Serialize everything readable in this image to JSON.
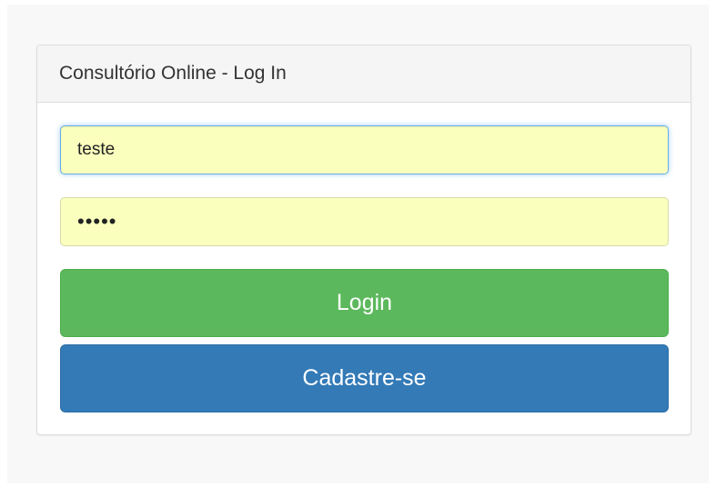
{
  "panel": {
    "title": "Consultório Online - Log In"
  },
  "form": {
    "username_value": "teste",
    "password_mask": "•••••"
  },
  "buttons": {
    "login_label": "Login",
    "register_label": "Cadastre-se"
  },
  "colors": {
    "login_button": "#5cb85c",
    "register_button": "#337ab7",
    "autofill_field": "#faffbd",
    "focus_ring": "#66afe9"
  }
}
